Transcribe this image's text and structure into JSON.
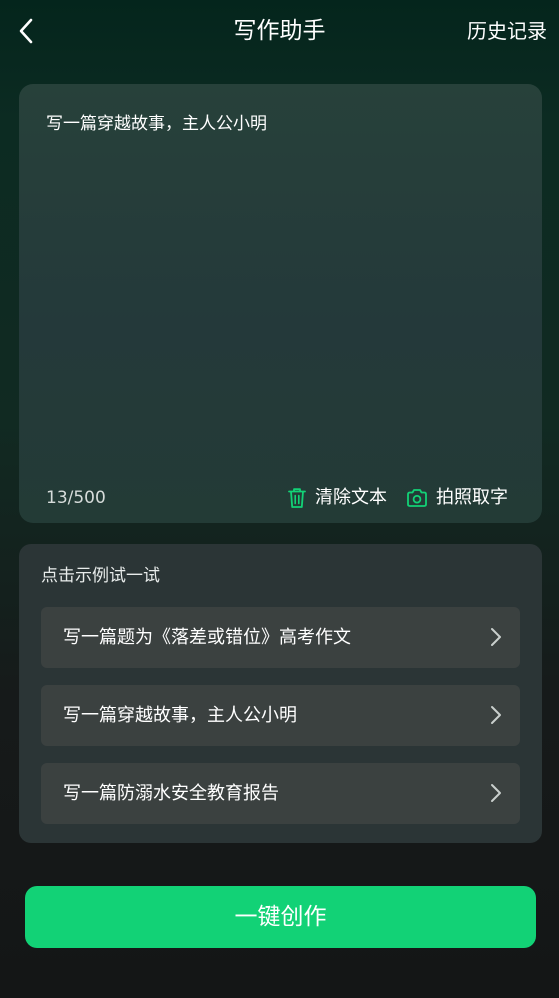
{
  "header": {
    "title": "写作助手",
    "history_label": "历史记录",
    "back_icon": "chevron-left-icon"
  },
  "editor": {
    "text": "写一篇穿越故事，主人公小明",
    "char_count": "13/500",
    "clear_label": "清除文本",
    "clear_icon": "trash-icon",
    "photo_label": "拍照取字",
    "photo_icon": "camera-icon",
    "accent_color": "#12d276"
  },
  "examples": {
    "title": "点击示例试一试",
    "items": [
      {
        "label": "写一篇题为《落差或错位》高考作文"
      },
      {
        "label": "写一篇穿越故事，主人公小明"
      },
      {
        "label": "写一篇防溺水安全教育报告"
      }
    ]
  },
  "action": {
    "create_label": "一键创作",
    "color": "#12d276"
  }
}
